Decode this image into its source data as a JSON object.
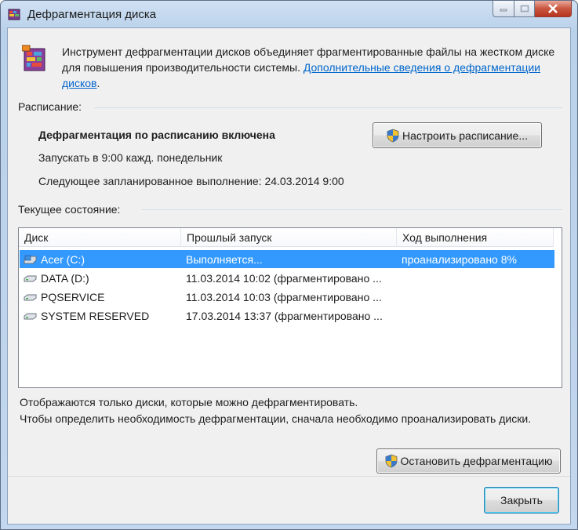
{
  "window": {
    "title": "Дефрагментация диска"
  },
  "intro": {
    "text": "Инструмент дефрагментации дисков объединяет фрагментированные файлы на жестком диске для повышения производительности системы. ",
    "link": "Дополнительные сведения о дефрагментации дисков",
    "after_link": "."
  },
  "schedule": {
    "label": "Расписание:",
    "status": "Дефрагментация по расписанию включена",
    "run_at": "Запускать в 9:00 кажд. понедельник",
    "next_run": "Следующее запланированное выполнение: 24.03.2014 9:00",
    "configure_button": "Настроить расписание..."
  },
  "current_state": {
    "label": "Текущее состояние:",
    "columns": [
      "Диск",
      "Прошлый запуск",
      "Ход выполнения"
    ],
    "rows": [
      {
        "disk": "Acer (C:)",
        "last_run": "Выполняется...",
        "progress": "проанализировано 8%",
        "selected": true
      },
      {
        "disk": "DATA (D:)",
        "last_run": "11.03.2014 10:02 (фрагментировано ...",
        "progress": "",
        "selected": false
      },
      {
        "disk": "PQSERVICE",
        "last_run": "11.03.2014 10:03 (фрагментировано ...",
        "progress": "",
        "selected": false
      },
      {
        "disk": "SYSTEM RESERVED",
        "last_run": "17.03.2014 13:37 (фрагментировано ...",
        "progress": "",
        "selected": false
      }
    ]
  },
  "notes": {
    "line1": "Отображаются только диски, которые можно дефрагментировать.",
    "line2": "Чтобы определить необходимость  дефрагментации, сначала необходимо проанализировать диски."
  },
  "buttons": {
    "stop": "Остановить дефрагментацию",
    "close": "Закрыть"
  },
  "colors": {
    "selection": "#3399ff",
    "link": "#0066cc"
  }
}
